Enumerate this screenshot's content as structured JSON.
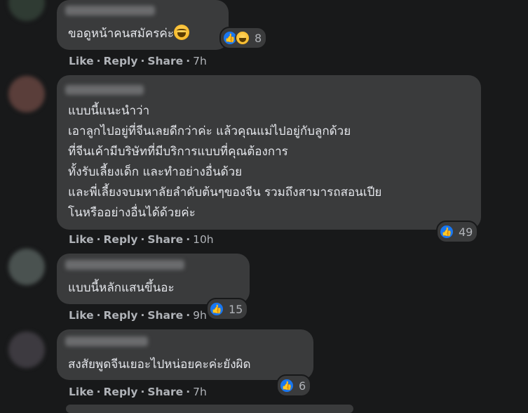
{
  "actions": {
    "like": "Like",
    "reply": "Reply",
    "share": "Share",
    "separator": "·"
  },
  "colors": {
    "background": "#18191a",
    "bubble": "#3a3b3c",
    "text": "#e4e6eb",
    "secondary_text": "#b0b3b8",
    "like_blue": "#1877f2"
  },
  "comments": [
    {
      "author": "",
      "lines": [
        "ขอดูหน้าคนสมัครค่ะ"
      ],
      "emoji": "laughing-tears-emoji",
      "reactions": [
        "like",
        "haha"
      ],
      "reaction_count": "8",
      "time": "7h"
    },
    {
      "author": "",
      "lines": [
        "แบบนี้แนะนำว่า",
        "เอาลูกไปอยู่ที่จีนเลยดีกว่าค่ะ แล้วคุณแม่ไปอยู่กับลูกด้วย",
        "ที่จีนเค้ามีบริษัทที่มีบริการแบบที่คุณต้องการ",
        "ทั้งรับเลี้ยงเด็ก และทำอย่างอื่นด้วย",
        "และพี่เลี้ยงจบมหาลัยลำดับต้นๆของจีน รวมถึงสามารถสอนเปีย",
        "โนหรืออย่างอื่นได้ด้วยค่ะ"
      ],
      "reactions": [
        "like"
      ],
      "reaction_count": "49",
      "time": "10h"
    },
    {
      "author": "",
      "lines": [
        "แบบนี้หลักแสนขึ้นอะ"
      ],
      "reactions": [
        "like"
      ],
      "reaction_count": "15",
      "time": "9h"
    },
    {
      "author": "",
      "lines": [
        "สงสัยพูดจีนเยอะไปหน่อยคะค่ะยังผิด"
      ],
      "reactions": [
        "like"
      ],
      "reaction_count": "6",
      "time": "7h"
    }
  ]
}
